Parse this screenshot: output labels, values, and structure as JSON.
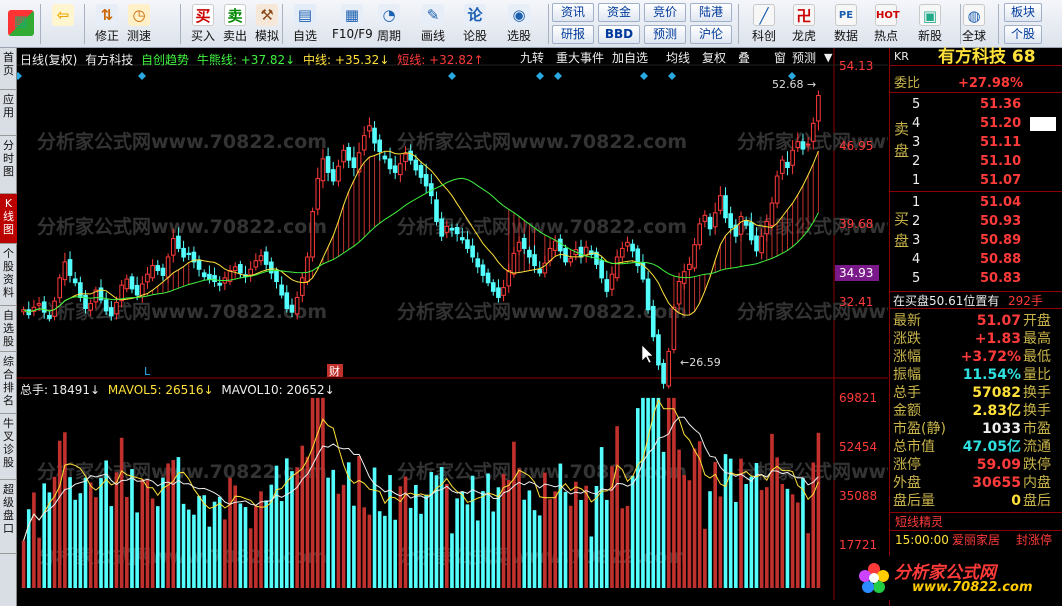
{
  "toolbar": {
    "buttons": [
      {
        "label": "",
        "icon": "windows-logo-icon"
      },
      {
        "label": "",
        "icon": "back-arrow-icon"
      },
      {
        "label": "修正",
        "icon": "up-down-arrows-icon"
      },
      {
        "label": "测速",
        "icon": "clock-icon"
      },
      {
        "label": "买入",
        "icon": "buy-icon",
        "glyph": "买"
      },
      {
        "label": "卖出",
        "icon": "sell-icon",
        "glyph": "卖"
      },
      {
        "label": "模拟",
        "icon": "hammer-icon"
      },
      {
        "label": "自选",
        "icon": "folder-icon"
      },
      {
        "label": "F10/F9",
        "icon": "document-icon"
      },
      {
        "label": "周期",
        "icon": "cycle-icon"
      },
      {
        "label": "画线",
        "icon": "pencil-icon"
      },
      {
        "label": "论股",
        "icon": "discuss-icon"
      },
      {
        "label": "选股",
        "icon": "stock-picker-icon"
      }
    ],
    "text_buttons": [
      [
        "资讯",
        "资金",
        "竞价",
        "陆港"
      ],
      [
        "研报",
        "BBD",
        "预测",
        "沪伦"
      ]
    ],
    "right_buttons": [
      {
        "label": "科创",
        "icon": "chart-icon"
      },
      {
        "label": "龙虎",
        "icon": "dragon-icon"
      },
      {
        "label": "数据",
        "icon": "pe-icon",
        "glyph": "PE"
      },
      {
        "label": "热点",
        "icon": "hot-icon",
        "glyph": "HOT"
      },
      {
        "label": "新股",
        "icon": "new-stock-icon"
      },
      {
        "label": "全球",
        "icon": "globe-icon"
      },
      {
        "label": "板块",
        "icon": ""
      },
      {
        "label": "个股",
        "icon": ""
      }
    ]
  },
  "left_tabs": [
    "首页",
    "应用",
    "分时图",
    "K线图",
    "个股资料",
    "自选股",
    "综合排名",
    "牛叉诊股",
    "超级盘口"
  ],
  "chart_header": {
    "period": "日线(复权)",
    "stock": "有方科技",
    "indicator": "自创趋势",
    "line1": "牛熊线: +37.82↓",
    "line2": "中线: +35.32↓",
    "line3": "短线: +32.82↑",
    "buttons": [
      "九转",
      "重大事件",
      "加自选",
      "均线",
      "复权",
      "叠",
      "窗",
      "预测"
    ]
  },
  "price_axis": [
    "54.13",
    "46.95",
    "39.68",
    "34.93",
    "32.41"
  ],
  "annotations": {
    "high": "52.68",
    "low": "26.59",
    "marker_L": "L",
    "marker_cai": "财"
  },
  "volume_header": {
    "total": "总手: 18491↓",
    "mavol5": "MAVOL5: 26516↓",
    "mavol10": "MAVOL10: 20652↓"
  },
  "volume_axis": [
    "69821",
    "52454",
    "35088",
    "17721"
  ],
  "watermark": "分析家公式网www.70822.com",
  "logo": {
    "text": "分析家公式网",
    "url": "www.70822.com"
  },
  "right_panel": {
    "code": "KR",
    "name": "有方科技 68",
    "weibi_label": "委比",
    "weibi_value": "+27.98%",
    "sell_label": "卖盘",
    "buy_label": "买盘",
    "sell": [
      [
        "5",
        "51.36"
      ],
      [
        "4",
        "51.20"
      ],
      [
        "3",
        "51.11"
      ],
      [
        "2",
        "51.10"
      ],
      [
        "1",
        "51.07"
      ]
    ],
    "buy": [
      [
        "1",
        "51.04"
      ],
      [
        "2",
        "50.93"
      ],
      [
        "3",
        "50.89"
      ],
      [
        "4",
        "50.88"
      ],
      [
        "5",
        "50.83"
      ]
    ],
    "position_text": "在买盘50.61位置有",
    "position_vol": "292手",
    "stats": [
      [
        "最新",
        "51.07",
        "开盘"
      ],
      [
        "涨跌",
        "+1.83",
        "最高"
      ],
      [
        "涨幅",
        "+3.72%",
        "最低"
      ],
      [
        "振幅",
        "11.54%",
        "量比"
      ],
      [
        "总手",
        "57082",
        "换手"
      ],
      [
        "金额",
        "2.83亿",
        "换手"
      ],
      [
        "市盈(静)",
        "1033",
        "市盈"
      ],
      [
        "总市值",
        "47.05亿",
        "流通"
      ],
      [
        "涨停",
        "59.09",
        "跌停"
      ],
      [
        "外盘",
        "30655",
        "内盘"
      ],
      [
        "盘后量",
        "0",
        "盘后"
      ]
    ],
    "elf_title": "短线精灵",
    "elf_time": "15:00:00",
    "elf_item": "爱丽家居",
    "elf_event": "封涨停"
  },
  "chart_data": {
    "type": "candlestick",
    "y_min": 26.59,
    "y_max": 52.68,
    "close": [
      33.6,
      33.2,
      33.8,
      34.1,
      33.4,
      32.9,
      34.3,
      36.2,
      37.5,
      36.4,
      35.8,
      34.6,
      33.7,
      34.1,
      35.2,
      34.4,
      33.5,
      33.1,
      34.2,
      35.6,
      36.1,
      35.3,
      34.8,
      35.7,
      36.5,
      37.2,
      36.8,
      36.4,
      37.9,
      39.4,
      38.6,
      37.9,
      38.1,
      37.5,
      36.9,
      36.3,
      36.1,
      35.9,
      35.6,
      36.2,
      36.8,
      37.1,
      36.6,
      36.3,
      36.9,
      37.6,
      38.0,
      37.3,
      36.6,
      35.9,
      34.8,
      33.7,
      33.4,
      34.6,
      36.2,
      37.9,
      41.6,
      44.3,
      45.9,
      44.8,
      44.1,
      45.3,
      46.6,
      45.8,
      45.2,
      46.4,
      47.8,
      48.6,
      47.2,
      46.5,
      45.9,
      45.1,
      44.8,
      45.5,
      46.3,
      45.8,
      45.0,
      44.4,
      43.7,
      42.9,
      40.8,
      39.6,
      40.4,
      40.1,
      39.8,
      39.3,
      38.6,
      37.9,
      37.1,
      36.4,
      35.8,
      35.1,
      34.6,
      35.4,
      36.8,
      38.2,
      39.1,
      38.6,
      37.9,
      37.2,
      36.6,
      37.4,
      38.6,
      39.2,
      38.4,
      37.5,
      37.8,
      38.5,
      37.9,
      38.7,
      38.1,
      37.3,
      36.2,
      35.1,
      36.5,
      37.9,
      38.6,
      39.1,
      38.4,
      37.2,
      36.1,
      33.6,
      31.4,
      29.1,
      27.6,
      30.2,
      33.8,
      35.9,
      36.7,
      37.3,
      38.9,
      40.6,
      41.3,
      40.2,
      41.5,
      42.9,
      41.1,
      40.3,
      39.6,
      41.2,
      40.5,
      39.3,
      38.4,
      39.6,
      40.8,
      42.3,
      44.5,
      45.8,
      45.2,
      46.6,
      47.3,
      46.7,
      47.1,
      48.8,
      51.07
    ],
    "volume_max": 69821,
    "mavol5": 26516,
    "mavol10": 20652,
    "last_volume": 18491
  }
}
